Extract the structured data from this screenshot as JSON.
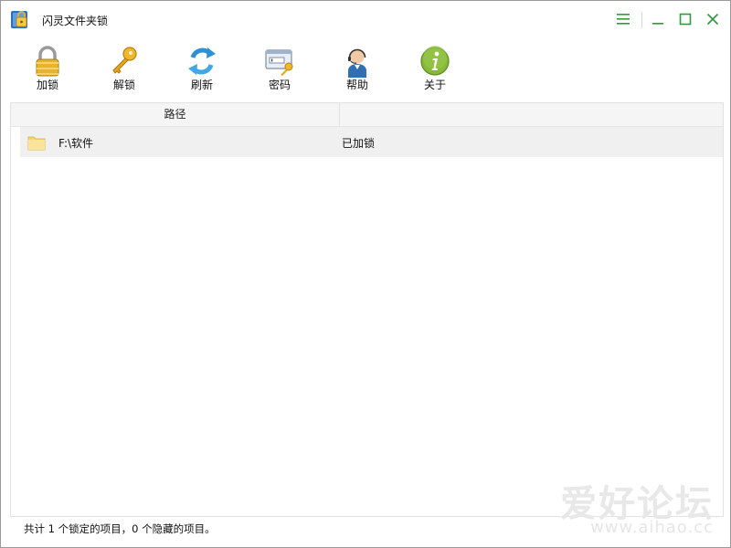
{
  "window": {
    "title": "闪灵文件夹锁"
  },
  "toolbar": {
    "items": [
      {
        "label": "加锁",
        "icon": "padlock-icon"
      },
      {
        "label": "解锁",
        "icon": "key-icon"
      },
      {
        "label": "刷新",
        "icon": "refresh-icon"
      },
      {
        "label": "密码",
        "icon": "password-icon"
      },
      {
        "label": "帮助",
        "icon": "support-agent-icon"
      },
      {
        "label": "关于",
        "icon": "info-icon"
      }
    ]
  },
  "list": {
    "columns": [
      "路径",
      ""
    ],
    "rows": [
      {
        "path": "F:\\软件",
        "status": "已加锁"
      }
    ]
  },
  "statusbar": {
    "text": "共计 1 个锁定的项目，0 个隐藏的项目。"
  },
  "watermark": {
    "main": "爱好论坛",
    "sub": "www.aihao.cc"
  },
  "colors": {
    "accent_green": "#2e9b3b",
    "row_bg": "#f0f0f0",
    "header_bg": "#f5f5f5"
  }
}
